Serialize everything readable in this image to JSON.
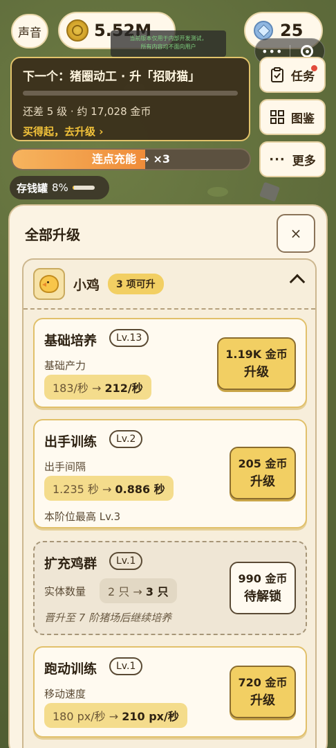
{
  "topbar": {
    "sound_label": "声音",
    "coins": "5.52M",
    "gems": "25",
    "notice_line1": "当前版本仅用于内部开发测试，",
    "notice_line2": "所有内容均不面向用户",
    "capsule_dots": "•••"
  },
  "goal": {
    "title": "下一个：猪圈动工 · 升「招财猫」",
    "progress": 0.02,
    "subtitle": "还差 5 级 · 约 17,028 金币",
    "link": "买得起，去升级 ›"
  },
  "side_buttons": {
    "tasks": "任务",
    "atlas": "图鉴",
    "more": "更多"
  },
  "combo": {
    "label": "连点充能 → ×3",
    "progress": 0.56
  },
  "piggy": {
    "label": "存钱罐",
    "percent": "8%",
    "progress": 0.08
  },
  "sheet": {
    "title": "全部升级",
    "close": "×",
    "group": {
      "name": "小鸡",
      "badge": "3 项可升",
      "cards": [
        {
          "name": "基础培养",
          "level": "Lv.13",
          "stat_label": "基础产力",
          "from": "183/秒 → ",
          "to": "212/秒",
          "price": "1.19K 金币",
          "action": "升级"
        },
        {
          "name": "出手训练",
          "level": "Lv.2",
          "stat_label": "出手间隔",
          "from": "1.235 秒 → ",
          "to": "0.886 秒",
          "note": "本阶位最高 Lv.3",
          "price": "205 金币",
          "action": "升级"
        },
        {
          "name": "扩充鸡群",
          "level": "Lv.1",
          "stat_label": "实体数量",
          "from": "2 只 → ",
          "to": "3 只",
          "note": "晋升至 7 阶猪场后继续培养",
          "price": "990 金币",
          "action": "待解锁"
        },
        {
          "name": "跑动训练",
          "level": "Lv.1",
          "stat_label": "移动速度",
          "from": "180 px/秒 → ",
          "to": "210 px/秒",
          "price": "720 金币",
          "action": "升级"
        }
      ]
    }
  }
}
